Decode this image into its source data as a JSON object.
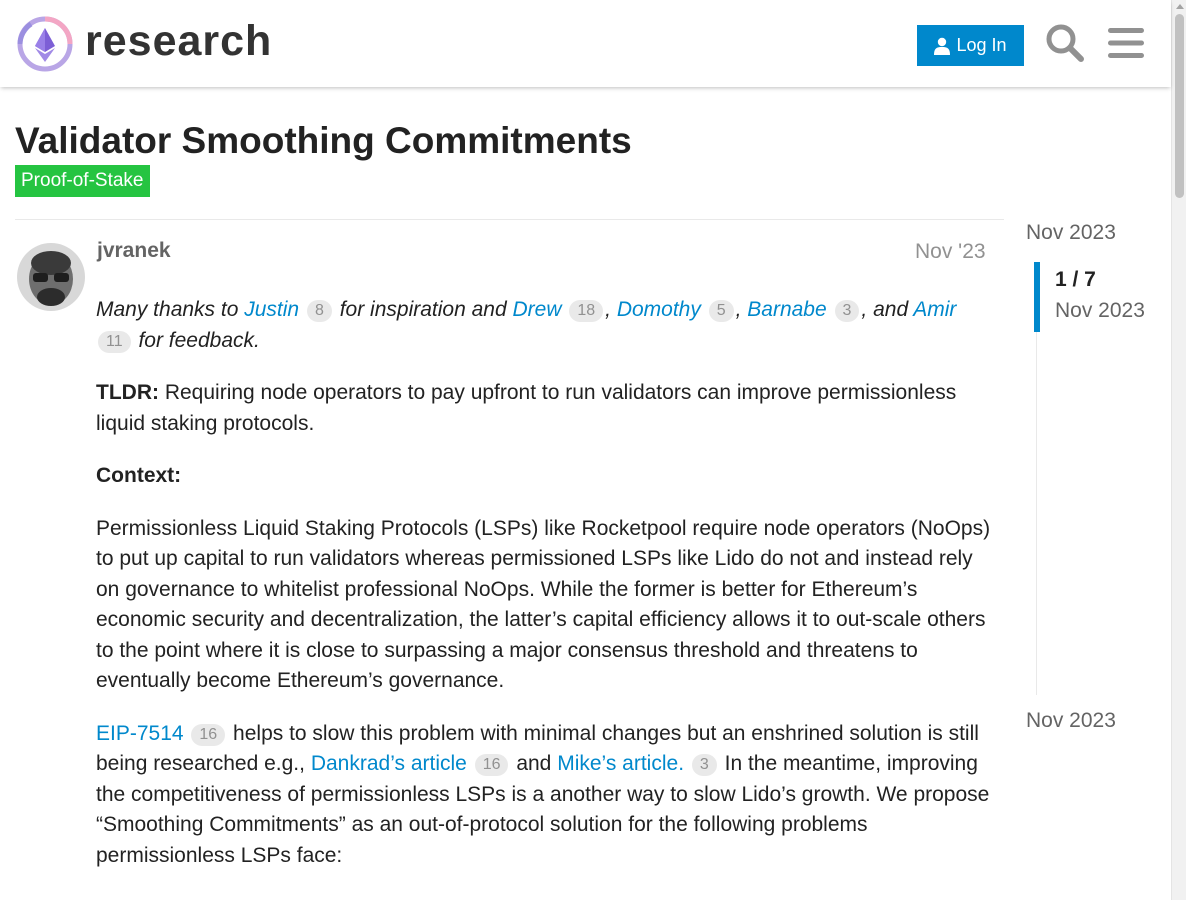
{
  "header": {
    "logo_text": "research",
    "login_label": "Log In"
  },
  "topic": {
    "title": "Validator Smoothing Commitments",
    "category": "Proof-of-Stake",
    "category_color": "#25c441"
  },
  "post": {
    "username": "jvranek",
    "date": "Nov '23",
    "thanks": {
      "prefix": "Many thanks to",
      "names": [
        {
          "name": "Justin",
          "count": "8"
        },
        {
          "name": "Drew",
          "count": "18"
        },
        {
          "name": "Domothy",
          "count": "5"
        },
        {
          "name": "Barnabe",
          "count": "3"
        },
        {
          "name": "Amir",
          "count": "11"
        }
      ],
      "for_inspiration": "for inspiration and",
      "and": ", and",
      "suffix": "for feedback."
    },
    "tldr_label": "TLDR:",
    "tldr_text": "Requiring node operators to pay upfront to run validators can improve permissionless liquid staking protocols.",
    "context_label": "Context:",
    "context_text": "Permissionless Liquid Staking Protocols (LSPs) like Rocketpool require node operators (NoOps) to put up capital to run validators whereas permissioned LSPs like Lido do not and instead rely on governance to whitelist professional NoOps. While the former is better for Ethereum’s economic security and decentralization, the latter’s capital efficiency allows it to out-scale others to the point where it is close to surpassing a major consensus threshold and threatens to eventually become Ethereum’s governance.",
    "eip": {
      "link": "EIP-7514",
      "link_count": "16",
      "text1": "helps to slow this problem with minimal changes but an enshrined solution is still being researched e.g.,",
      "dankrad": "Dankrad’s article",
      "dankrad_count": "16",
      "and": "and",
      "mike": "Mike’s article.",
      "mike_count": "3",
      "text2": "In the meantime, improving the competitiveness of permissionless LSPs is a another way to slow Lido’s growth. We propose “Smoothing Commitments” as an out-of-protocol solution for the following problems permissionless LSPs face:"
    }
  },
  "timeline": {
    "top_date": "Nov 2023",
    "position": "1 / 7",
    "position_date": "Nov 2023",
    "bottom_date": "Nov 2023",
    "accent": "#0088cc"
  }
}
